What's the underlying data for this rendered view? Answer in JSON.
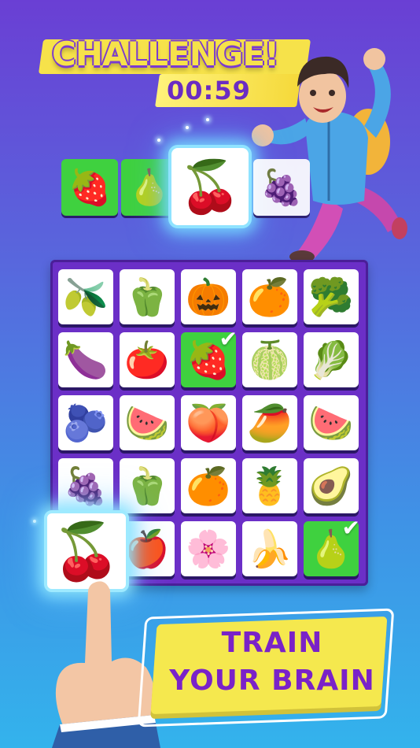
{
  "header": {
    "title": "CHALLENGE!",
    "timer": "00:59"
  },
  "tray": {
    "slots": [
      {
        "icon": "strawberry-icon",
        "glyph": "🍓",
        "state": "green"
      },
      {
        "icon": "pear-icon",
        "glyph": "🍐",
        "state": "green"
      },
      {
        "icon": "cherries-icon",
        "glyph": "🍒",
        "state": "highlighted"
      },
      {
        "icon": "grapes-icon",
        "glyph": "🍇",
        "state": "white"
      }
    ]
  },
  "board": {
    "rows": [
      [
        {
          "icon": "fig-icon",
          "glyph": "🫒",
          "state": "white"
        },
        {
          "icon": "red-pepper-icon",
          "glyph": "🫑",
          "state": "white"
        },
        {
          "icon": "pumpkin-icon",
          "glyph": "🎃",
          "state": "white"
        },
        {
          "icon": "orange-icon",
          "glyph": "🍊",
          "state": "white"
        },
        {
          "icon": "broccoli-icon",
          "glyph": "🥦",
          "state": "white"
        }
      ],
      [
        {
          "icon": "eggplant-icon",
          "glyph": "🍆",
          "state": "white"
        },
        {
          "icon": "tomato-icon",
          "glyph": "🍅",
          "state": "white"
        },
        {
          "icon": "strawberry-icon",
          "glyph": "🍓",
          "state": "matched"
        },
        {
          "icon": "melon-icon",
          "glyph": "🍈",
          "state": "white"
        },
        {
          "icon": "artichoke-icon",
          "glyph": "🥬",
          "state": "white"
        }
      ],
      [
        {
          "icon": "plum-icon",
          "glyph": "🫐",
          "state": "white"
        },
        {
          "icon": "watermelon-slice-icon",
          "glyph": "🍉",
          "state": "white"
        },
        {
          "icon": "peach-icon",
          "glyph": "🍑",
          "state": "white"
        },
        {
          "icon": "mango-icon",
          "glyph": "🥭",
          "state": "white"
        },
        {
          "icon": "watermelon-icon",
          "glyph": "🍉",
          "state": "white"
        }
      ],
      [
        {
          "icon": "grapes-icon",
          "glyph": "🍇",
          "state": "white"
        },
        {
          "icon": "bell-pepper-icon",
          "glyph": "🫑",
          "state": "white"
        },
        {
          "icon": "grapefruit-icon",
          "glyph": "🍊",
          "state": "white"
        },
        {
          "icon": "pineapple-icon",
          "glyph": "🍍",
          "state": "white"
        },
        {
          "icon": "avocado-icon",
          "glyph": "🥑",
          "state": "white"
        }
      ],
      [
        {
          "icon": "cherries-icon",
          "glyph": "🍒",
          "state": "white"
        },
        {
          "icon": "apple-icon",
          "glyph": "🍎",
          "state": "white"
        },
        {
          "icon": "dragon-fruit-icon",
          "glyph": "🌸",
          "state": "white"
        },
        {
          "icon": "banana-icon",
          "glyph": "🍌",
          "state": "white"
        },
        {
          "icon": "pear-icon",
          "glyph": "🍐",
          "state": "matched"
        }
      ]
    ]
  },
  "picked_tile": {
    "icon": "cherries-icon",
    "glyph": "🍒"
  },
  "cta": {
    "line1": "TRAIN",
    "line2": "YOUR BRAIN"
  },
  "colors": {
    "accent_yellow": "#f5e84e",
    "brand_purple": "#7a22c8",
    "matched_green": "#3fd13f"
  }
}
